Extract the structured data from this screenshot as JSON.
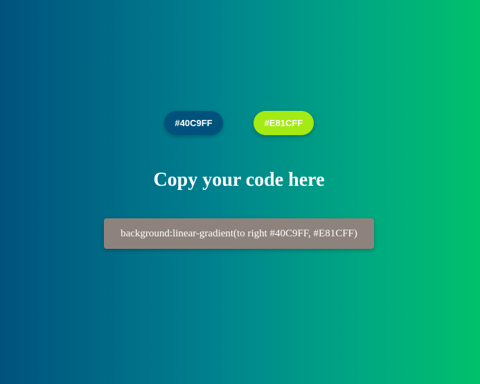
{
  "color_buttons": {
    "first": {
      "label": "#40C9FF",
      "bg": "#00527d"
    },
    "second": {
      "label": "#E81CFF",
      "bg": "#a4ea13"
    }
  },
  "heading": "Copy your code here",
  "code_box": {
    "text": "background:linear-gradient(to right #40C9FF, #E81CFF)",
    "bg": "#8e837c"
  },
  "background": {
    "colors": [
      "#00527d",
      "#00828f",
      "#00a782",
      "#00c06b"
    ]
  }
}
